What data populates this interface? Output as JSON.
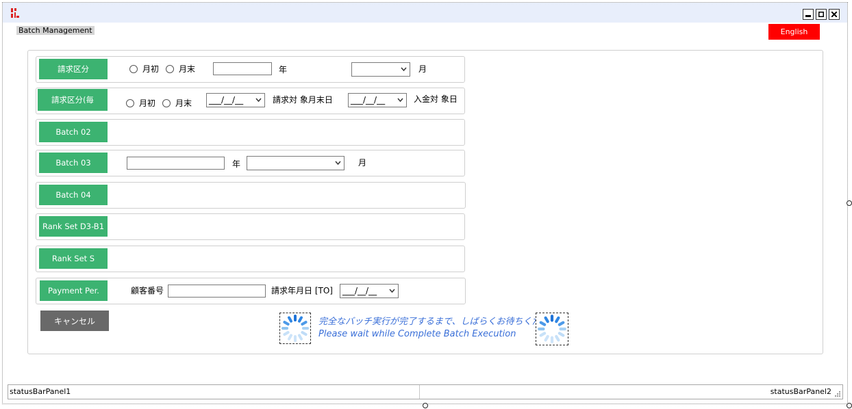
{
  "window": {
    "menu_label": "Batch Management",
    "language_button": "English"
  },
  "rows": [
    {
      "button": "請求区分",
      "radio1": "月初",
      "radio2": "月末",
      "year_label": "年",
      "month_label": "月",
      "month_select": ""
    },
    {
      "button": "請求区分(毎",
      "radio1": "月初",
      "radio2": "月末",
      "date_select1": "___/__/__",
      "label1": "請求対 象月末日",
      "date_select2": "___/__/__",
      "label2": "入金対 象日"
    },
    {
      "button": "Batch 02"
    },
    {
      "button": "Batch 03",
      "year_label": "年",
      "month_label": "月",
      "month_select": ""
    },
    {
      "button": "Batch 04"
    },
    {
      "button": "Rank Set D3-B1"
    },
    {
      "button": "Rank Set S"
    },
    {
      "button": "Payment Per.",
      "customer_label": "顧客番号",
      "date_label": "請求年月日 [TO]",
      "date_select": "___/__/__"
    }
  ],
  "cancel_button": "キャンセル",
  "wait_message": {
    "ja": "完全なバッチ実行が完了するまで、しばらくお待ちください",
    "en": "Please wait while Complete Batch Execution"
  },
  "status_bar": {
    "panel1": "statusBarPanel1",
    "panel2": "statusBarPanel2"
  },
  "colors": {
    "green_button": "#3cb371",
    "language_button": "#ff0000",
    "cancel_button": "#696969",
    "wait_text": "#3a6fd8"
  }
}
